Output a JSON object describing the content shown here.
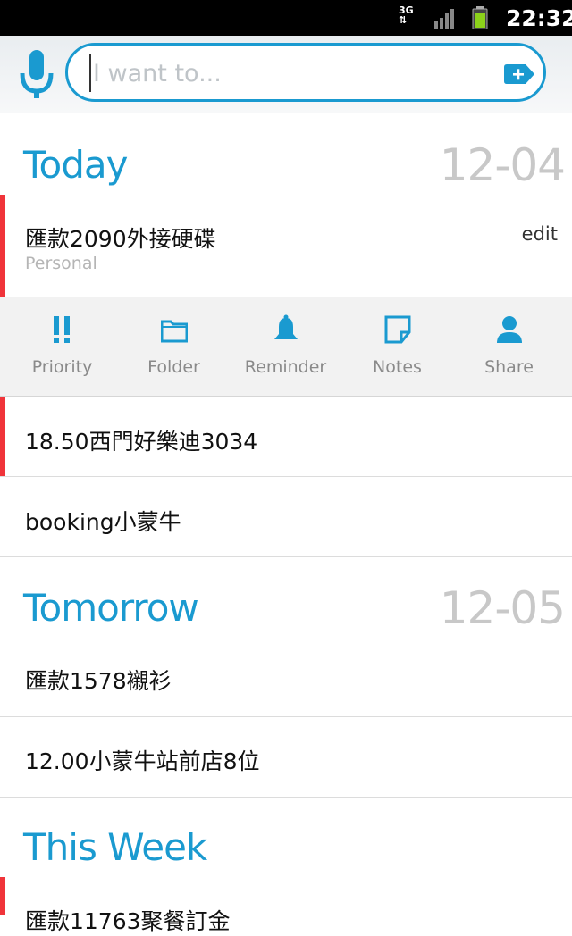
{
  "status_bar": {
    "network": "3G",
    "time": "22:32"
  },
  "search": {
    "placeholder": "I want to...",
    "value": ""
  },
  "sections": [
    {
      "title": "Today",
      "date": "12-04"
    },
    {
      "title": "Tomorrow",
      "date": "12-05"
    },
    {
      "title": "This Week",
      "date": ""
    }
  ],
  "tasks": {
    "today": [
      {
        "title": "匯款2090外接硬碟",
        "category": "Personal",
        "edit_label": "edit",
        "priority": true
      },
      {
        "title": "18.50西門好樂迪3034",
        "priority": true
      },
      {
        "title": "booking小蒙牛",
        "priority": false
      }
    ],
    "tomorrow": [
      {
        "title": "匯款1578襯衫",
        "priority": false
      },
      {
        "title": "12.00小蒙牛站前店8位",
        "priority": false
      }
    ],
    "this_week": [
      {
        "title": "匯款11763聚餐訂金",
        "priority": true
      }
    ]
  },
  "actions": [
    {
      "label": "Priority",
      "icon": "priority-icon"
    },
    {
      "label": "Folder",
      "icon": "folder-icon"
    },
    {
      "label": "Reminder",
      "icon": "bell-icon"
    },
    {
      "label": "Notes",
      "icon": "note-icon"
    },
    {
      "label": "Share",
      "icon": "person-icon"
    }
  ],
  "colors": {
    "accent": "#1a9ad0",
    "priority_flag": "#f0343a",
    "date_gray": "#c8c8c8"
  }
}
